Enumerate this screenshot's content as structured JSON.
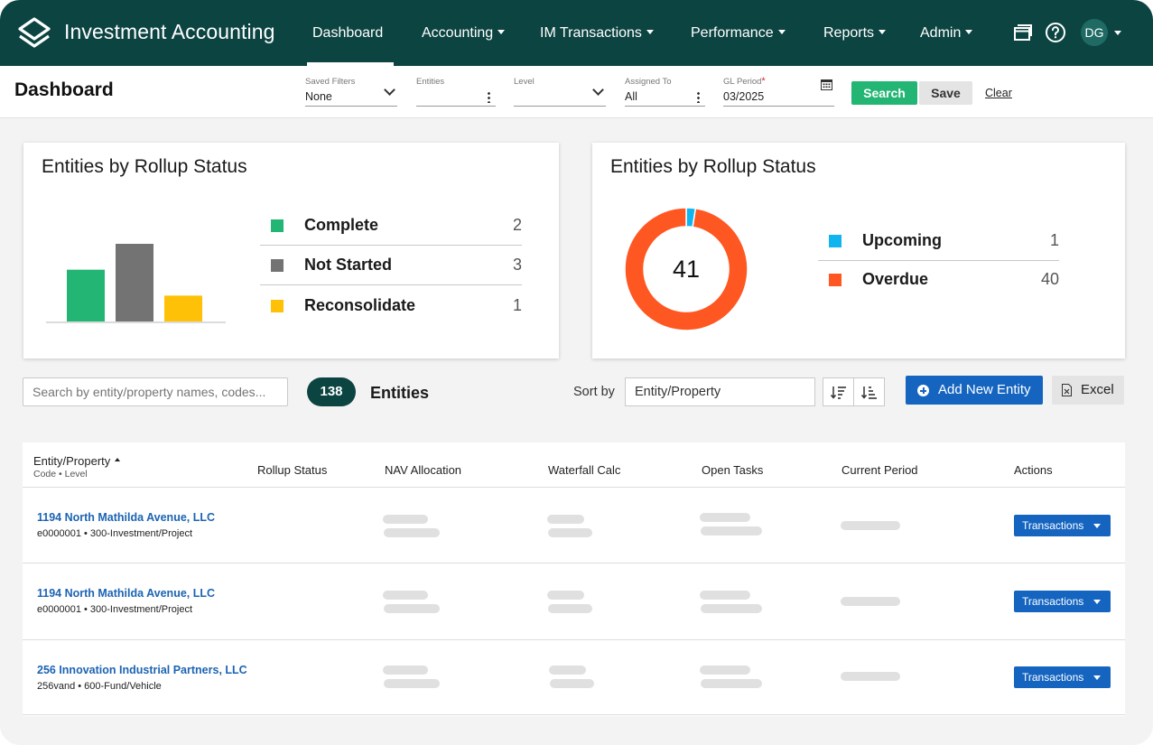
{
  "app": {
    "title": "Investment Accounting"
  },
  "nav": {
    "items": [
      {
        "label": "Dashboard",
        "has_menu": false
      },
      {
        "label": "Accounting",
        "has_menu": true
      },
      {
        "label": "IM Transactions",
        "has_menu": true
      },
      {
        "label": "Performance",
        "has_menu": true
      },
      {
        "label": "Reports",
        "has_menu": true
      },
      {
        "label": "Admin",
        "has_menu": true
      }
    ],
    "active": "Dashboard",
    "user_initials": "DG"
  },
  "filterbar": {
    "title": "Dashboard",
    "saved_filters": {
      "label": "Saved Filters",
      "value": "None"
    },
    "entities": {
      "label": "Entities",
      "value": ""
    },
    "level": {
      "label": "Level",
      "value": ""
    },
    "assigned_to": {
      "label": "Assigned To",
      "value": "All"
    },
    "gl_period": {
      "label": "GL Period",
      "required_mark": "*",
      "value": "03/2025"
    },
    "search_label": "Search",
    "save_label": "Save",
    "clear_label": "Clear"
  },
  "colors": {
    "nav_bg": "#0c4442",
    "complete": "#22b573",
    "not_started": "#737373",
    "reconsolidate": "#ffc107",
    "upcoming": "#10b5f0",
    "overdue": "#ff5722",
    "primary": "#1565c0",
    "link": "#1c64b3"
  },
  "chart_data": [
    {
      "type": "bar",
      "title": "Entities by Rollup Status",
      "categories": [
        "Complete",
        "Not Started",
        "Reconsolidate"
      ],
      "values": [
        2,
        3,
        1
      ],
      "colors": [
        "#22b573",
        "#737373",
        "#ffc107"
      ],
      "ylim": [
        0,
        3
      ],
      "legend_position": "right",
      "grid": false
    },
    {
      "type": "pie",
      "title": "Entities by Rollup Status",
      "center_label": "41",
      "categories": [
        "Upcoming",
        "Overdue"
      ],
      "values": [
        1,
        40
      ],
      "colors": [
        "#10b5f0",
        "#ff5722"
      ],
      "legend_position": "right"
    }
  ],
  "toolbar": {
    "search_placeholder": "Search by entity/property names, codes...",
    "entity_count": "138",
    "entities_label": "Entities",
    "sort_by_label": "Sort by",
    "sort_value": "Entity/Property",
    "add_label": "Add New Entity",
    "excel_label": "Excel"
  },
  "table": {
    "headers": {
      "entity": "Entity/Property",
      "entity_sub": "Code • Level",
      "rollup": "Rollup Status",
      "nav": "NAV Allocation",
      "waterfall": "Waterfall Calc",
      "tasks": "Open Tasks",
      "period": "Current Period",
      "actions": "Actions"
    },
    "rows": [
      {
        "name": "1194 North Mathilda Avenue, LLC",
        "sub": "e0000001 • 300-Investment/Project",
        "action": "Transactions"
      },
      {
        "name": "1194 North Mathilda Avenue, LLC",
        "sub": "e0000001 • 300-Investment/Project",
        "action": "Transactions"
      },
      {
        "name": "256 Innovation Industrial Partners, LLC",
        "sub": "256vand • 600-Fund/Vehicle",
        "action": "Transactions"
      }
    ]
  }
}
